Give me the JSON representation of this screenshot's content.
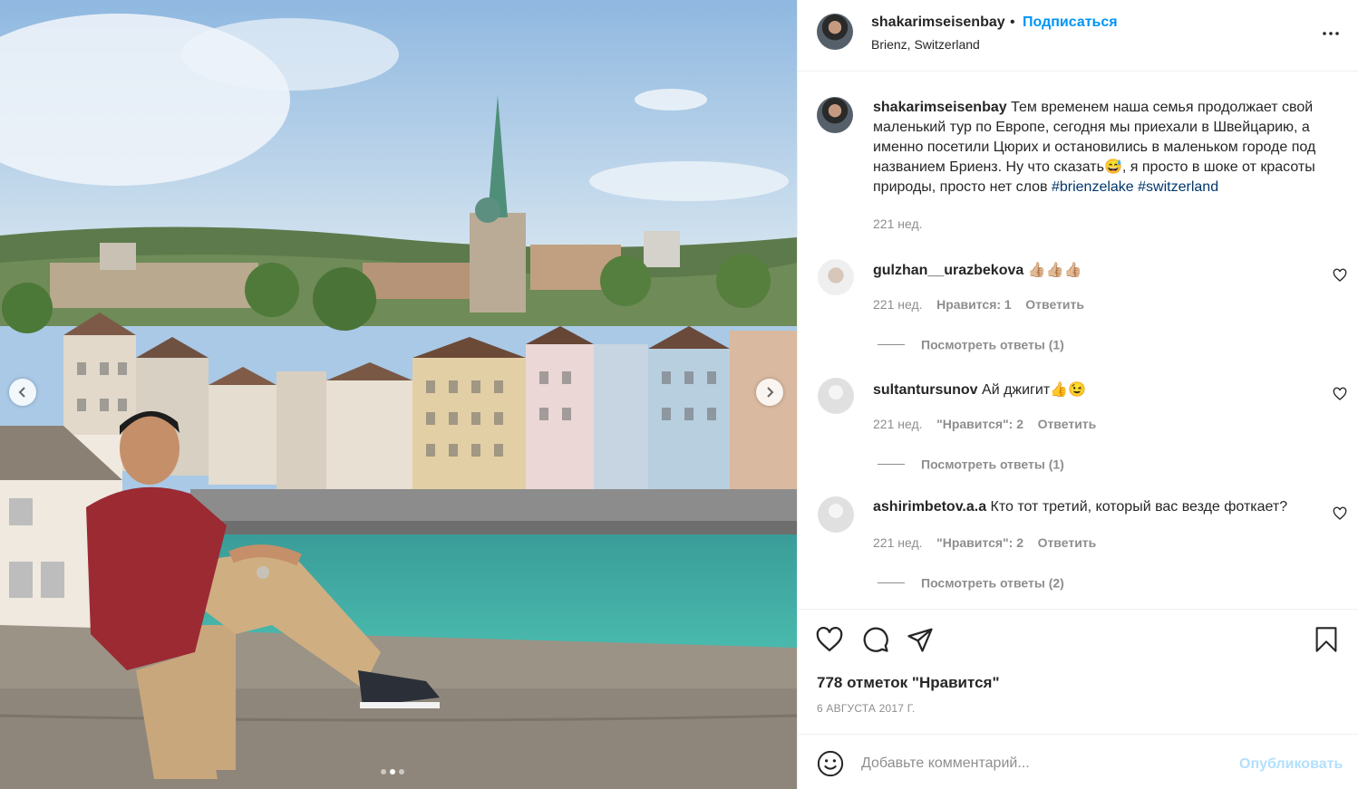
{
  "post": {
    "owner": "shakarimseisenbay",
    "separator": "•",
    "follow_label": "Подписаться",
    "location": "Brienz, Switzerland",
    "more_icon": "more-horizontal-icon"
  },
  "carousel": {
    "slides_total": 3,
    "active_slide": 2,
    "prev_icon": "chevron-left-icon",
    "next_icon": "chevron-right-icon"
  },
  "caption": {
    "username": "shakarimseisenbay",
    "text_before_emoji": " Тем временем наша семья продолжает свой маленький тур по Европе, сегодня мы приехали в Швейцарию, а именно посетили Цюрих и остановились в маленьком городе под названием Бриенз. Ну что сказать",
    "emoji": "😅",
    "text_after_emoji": ", я просто в шоке от красоты природы, просто нет слов ",
    "hashtag_1": "#brienzelake",
    "space": " ",
    "hashtag_2": "#switzerland",
    "time": "221 нед."
  },
  "comments": [
    {
      "username": "gulzhan__urazbekova",
      "text": "👍🏼👍🏼👍🏼",
      "time": "221 нед.",
      "likes": "Нравится: 1",
      "reply_label": "Ответить",
      "view_replies": "Посмотреть ответы (1)"
    },
    {
      "username": "sultantursunov",
      "text": "Ай джигит👍😉",
      "time": "221 нед.",
      "likes": "\"Нравится\": 2",
      "reply_label": "Ответить",
      "view_replies": "Посмотреть ответы (1)"
    },
    {
      "username": "ashirimbetov.a.a",
      "text": "Кто тот третий, который вас везде фоткает?",
      "time": "221 нед.",
      "likes": "\"Нравится\": 2",
      "reply_label": "Ответить",
      "view_replies": "Посмотреть ответы (2)"
    }
  ],
  "actions": {
    "like_icon": "heart-icon",
    "comment_icon": "comment-icon",
    "share_icon": "paper-plane-icon",
    "save_icon": "bookmark-icon",
    "likes_text": "778 отметок \"Нравится\"",
    "date": "6 АВГУСТА 2017 Г."
  },
  "add_comment": {
    "emoji_icon": "smiley-icon",
    "placeholder": "Добавьте комментарий...",
    "publish_label": "Опубликовать"
  },
  "colors": {
    "link_blue": "#0095f6",
    "hashtag_blue": "#00376b",
    "muted_gray": "#8e8e8e",
    "publish_disabled": "#b2dffc",
    "text": "#262626"
  }
}
